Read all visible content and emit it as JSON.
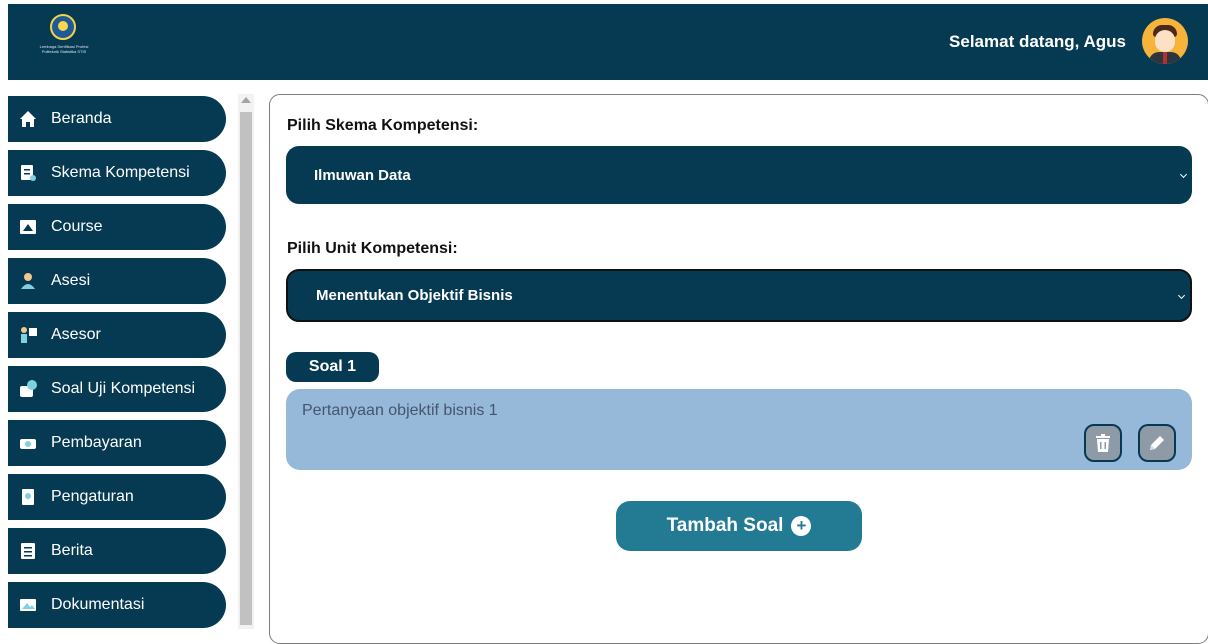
{
  "header": {
    "logo_text": "Lembaga Sertifikasi Profesi Politeknik Statistika STIS",
    "greeting": "Selamat datang, Agus"
  },
  "sidebar": {
    "items": [
      {
        "label": "Beranda",
        "icon": "home-icon"
      },
      {
        "label": "Skema Kompetensi",
        "icon": "document-icon"
      },
      {
        "label": "Course",
        "icon": "course-icon"
      },
      {
        "label": "Asesi",
        "icon": "user-icon"
      },
      {
        "label": "Asesor",
        "icon": "presenter-icon"
      },
      {
        "label": "Soal Uji Kompetensi",
        "icon": "question-icon"
      },
      {
        "label": "Pembayaran",
        "icon": "money-icon"
      },
      {
        "label": "Pengaturan",
        "icon": "settings-icon"
      },
      {
        "label": "Berita",
        "icon": "news-icon"
      },
      {
        "label": "Dokumentasi",
        "icon": "image-icon"
      }
    ]
  },
  "form": {
    "skema_label": "Pilih Skema Kompetensi:",
    "skema_value": "Ilmuwan Data",
    "unit_label": "Pilih Unit Kompetensi:",
    "unit_value": "Menentukan Objektif Bisnis"
  },
  "questions": [
    {
      "badge": "Soal 1",
      "text": "Pertanyaan objektif bisnis 1"
    }
  ],
  "actions": {
    "add_question_label": "Tambah Soal"
  },
  "colors": {
    "primary": "#063a52",
    "accent": "#227b93",
    "question_bg": "#96b8d9"
  }
}
